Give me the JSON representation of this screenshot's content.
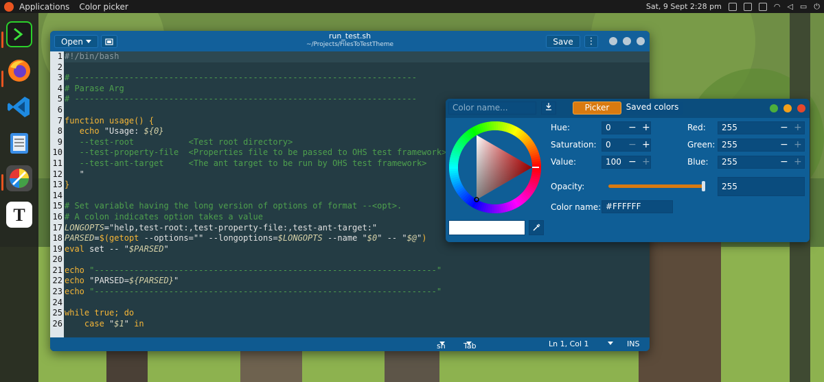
{
  "topbar": {
    "menu1": "Applications",
    "menu2": "Color picker",
    "datetime": "Sat, 9 Sept  2:28 pm"
  },
  "dock": {
    "apps": [
      "terminal-icon",
      "firefox-icon",
      "vscode-icon",
      "files-icon",
      "color-picker-icon",
      "text-editor-icon"
    ]
  },
  "editor": {
    "open_label": "Open",
    "save_label": "Save",
    "title": "run_test.sh",
    "subtitle": "~/Projects/FilesToTestTheme",
    "line_numbers": [
      "1",
      "2",
      "3",
      "4",
      "5",
      "6",
      "7",
      "8",
      "9",
      "10",
      "11",
      "12",
      "13",
      "14",
      "15",
      "16",
      "17",
      "18",
      "19",
      "20",
      "21",
      "22",
      "23",
      "24",
      "25",
      "26"
    ],
    "status": {
      "language": "sh",
      "tab_width": "Tab Width: 2",
      "cursor": "Ln 1, Col 1",
      "mode": "INS"
    }
  },
  "picker": {
    "color_name_placeholder": "Color name...",
    "tab_picker": "Picker",
    "tab_saved": "Saved colors",
    "hue_label": "Hue:",
    "hue": "0",
    "sat_label": "Saturation:",
    "sat": "0",
    "val_label": "Value:",
    "val": "100",
    "red_label": "Red:",
    "red": "255",
    "green_label": "Green:",
    "green": "255",
    "blue_label": "Blue:",
    "blue": "255",
    "opacity_label": "Opacity:",
    "opacity": "255",
    "opacity_fraction": 1.0,
    "colorname_label": "Color name:",
    "colorname": "#FFFFFF",
    "current_color": "#FFFFFF"
  }
}
